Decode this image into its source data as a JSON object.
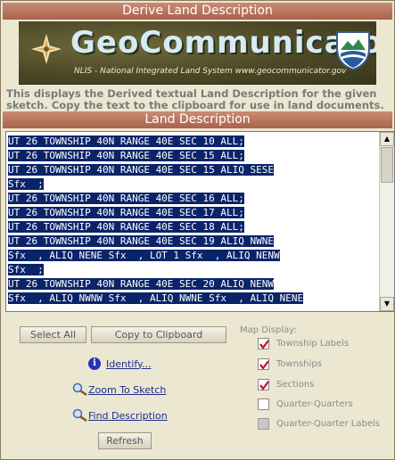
{
  "window": {
    "title": "Derive Land Description"
  },
  "banner": {
    "title": "GeoCommunicator",
    "subtitle": "NLIS - National Integrated Land System   www.geocommunicator.gov"
  },
  "description": "This displays the Derived textual Land Description for the given sketch. Copy the text to the clipboard for use in land documents.",
  "land_description": {
    "header": "Land Description",
    "lines": [
      "UT 26 TOWNSHIP 40N RANGE 40E SEC 10 ALL;",
      "UT 26 TOWNSHIP 40N RANGE 40E SEC 15 ALL;",
      "UT 26 TOWNSHIP 40N RANGE 40E SEC 15 ALIQ SESE",
      "Sfx  ;",
      "UT 26 TOWNSHIP 40N RANGE 40E SEC 16 ALL;",
      "UT 26 TOWNSHIP 40N RANGE 40E SEC 17 ALL;",
      "UT 26 TOWNSHIP 40N RANGE 40E SEC 18 ALL;",
      "UT 26 TOWNSHIP 40N RANGE 40E SEC 19 ALIQ NWNE",
      "Sfx  , ALIQ NENE Sfx  , LOT 1 Sfx  , ALIQ NENW",
      "Sfx  ;",
      "UT 26 TOWNSHIP 40N RANGE 40E SEC 20 ALIQ NENW",
      "Sfx  , ALIQ NWNW Sfx  , ALIQ NWNE Sfx  , ALIQ NENE"
    ]
  },
  "buttons": {
    "select_all": "Select All",
    "copy_to_clipboard": "Copy to Clipboard",
    "refresh": "Refresh"
  },
  "links": {
    "identify": "Identify...",
    "zoom_to_sketch": "Zoom To Sketch",
    "find_description": "Find Description"
  },
  "map_display": {
    "label": "Map Display:",
    "options": [
      {
        "label": "Township Labels",
        "checked": true,
        "enabled": true
      },
      {
        "label": "Townships",
        "checked": true,
        "enabled": true
      },
      {
        "label": "Sections",
        "checked": true,
        "enabled": true
      },
      {
        "label": "Quarter-Quarters",
        "checked": false,
        "enabled": true
      },
      {
        "label": "Quarter-Quarter Labels",
        "checked": false,
        "enabled": false
      }
    ]
  },
  "colors": {
    "title_bar": "#b36f58",
    "selection": "#0a246a",
    "link": "#1d2e8c",
    "checkmark": "#c0122c"
  },
  "icons": {
    "info": "info-icon",
    "magnifier": "magnifier-icon",
    "checkbox": "checkbox-icon"
  }
}
